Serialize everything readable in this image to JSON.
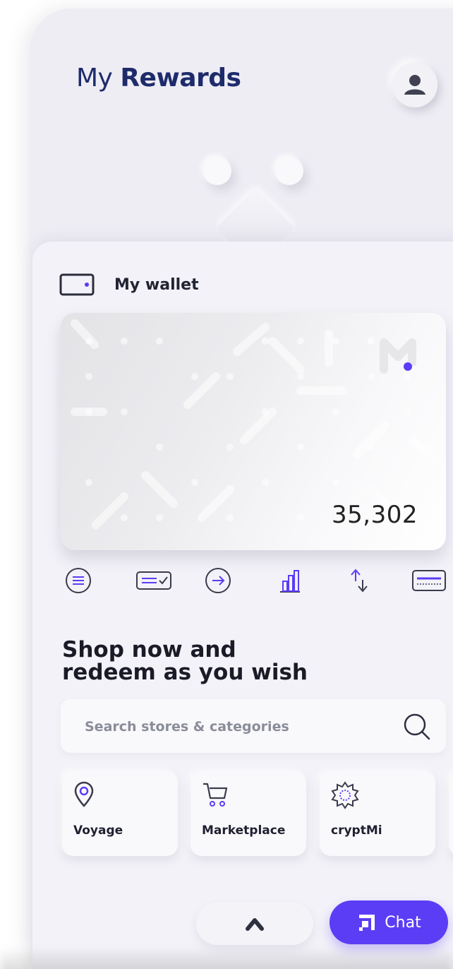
{
  "header": {
    "title_light": "My",
    "title_bold": "Rewards"
  },
  "wallet": {
    "label": "My wallet",
    "amount": "35,302"
  },
  "card_actions": [
    {
      "icon": "menu-circle-icon"
    },
    {
      "icon": "ticket-check-icon"
    },
    {
      "icon": "arrow-right-circle-icon"
    },
    {
      "icon": "bar-chart-icon"
    },
    {
      "icon": "exchange-icon"
    },
    {
      "icon": "credit-card-icon"
    }
  ],
  "shop": {
    "heading": "Shop now and\nredeem as you wish"
  },
  "search": {
    "placeholder": "Search stores & categories"
  },
  "categories": [
    {
      "label": "Voyage",
      "icon": "location-pin-icon"
    },
    {
      "label": "Marketplace",
      "icon": "cart-icon"
    },
    {
      "label": "cryptMi",
      "icon": "crypto-badge-icon"
    }
  ],
  "bottom": {
    "chat_label": "Chat"
  },
  "colors": {
    "accent": "#5b3df5",
    "title": "#1e2b6b",
    "background": "#eeedf4"
  }
}
